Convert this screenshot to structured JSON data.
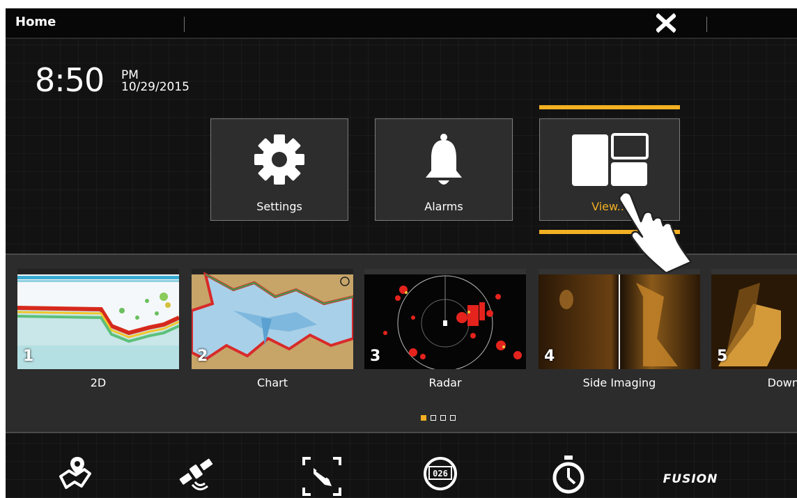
{
  "header": {
    "title": "Home",
    "close_label": "X"
  },
  "clock": {
    "time": "8:50",
    "ampm": "PM",
    "date": "10/29/2015"
  },
  "tiles": [
    {
      "label": "Settings",
      "icon": "gear-icon"
    },
    {
      "label": "Alarms",
      "icon": "bell-icon"
    },
    {
      "label": "View...",
      "icon": "layout-icon",
      "selected": true
    }
  ],
  "views": [
    {
      "number": "1",
      "label": "2D"
    },
    {
      "number": "2",
      "label": "Chart"
    },
    {
      "number": "3",
      "label": "Radar"
    },
    {
      "number": "4",
      "label": "Side Imaging"
    },
    {
      "number": "5",
      "label": "Down Im"
    }
  ],
  "pagination": {
    "pages": 4,
    "active": 1
  },
  "bottom_tools": [
    {
      "icon": "map-pin-icon"
    },
    {
      "icon": "satellite-icon"
    },
    {
      "icon": "boat-target-icon"
    },
    {
      "icon": "trip-log-icon"
    },
    {
      "icon": "stopwatch-icon"
    },
    {
      "icon": "fusion-logo",
      "label": "FUSION"
    }
  ],
  "colors": {
    "accent": "#f3b022",
    "background": "#121212",
    "tile": "#2d2d2d"
  }
}
